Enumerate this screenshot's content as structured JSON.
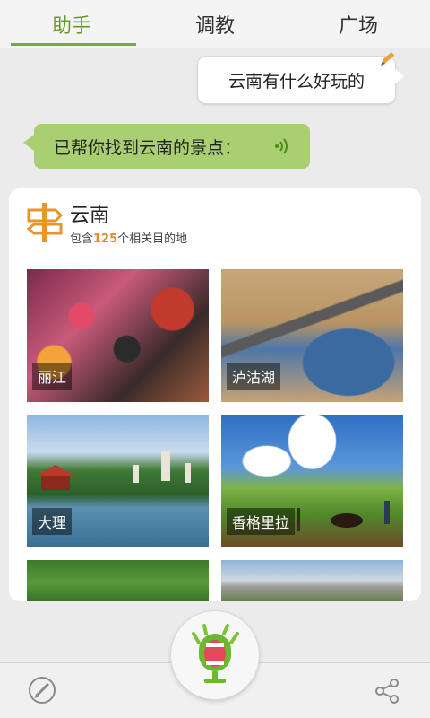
{
  "tabs": [
    {
      "label": "助手"
    },
    {
      "label": "调教"
    },
    {
      "label": "广场"
    }
  ],
  "chat": {
    "user_message": "云南有什么好玩的",
    "bot_message": "已帮你找到云南的景点："
  },
  "card": {
    "title": "云南",
    "subtitle_prefix": "包含",
    "count": "125",
    "subtitle_suffix": "个相关目的地",
    "places": [
      {
        "label": "丽江"
      },
      {
        "label": "泸沽湖"
      },
      {
        "label": "大理"
      },
      {
        "label": "香格里拉"
      }
    ]
  },
  "colors": {
    "accent_green": "#7aa83a",
    "bubble_green": "#a9cf72",
    "count_orange": "#e48d1e"
  },
  "icons": {
    "edit": "pencil-icon",
    "sound": "sound-wave-icon",
    "sign": "signpost-icon",
    "mic": "microphone-mascot-icon",
    "share": "share-icon"
  }
}
